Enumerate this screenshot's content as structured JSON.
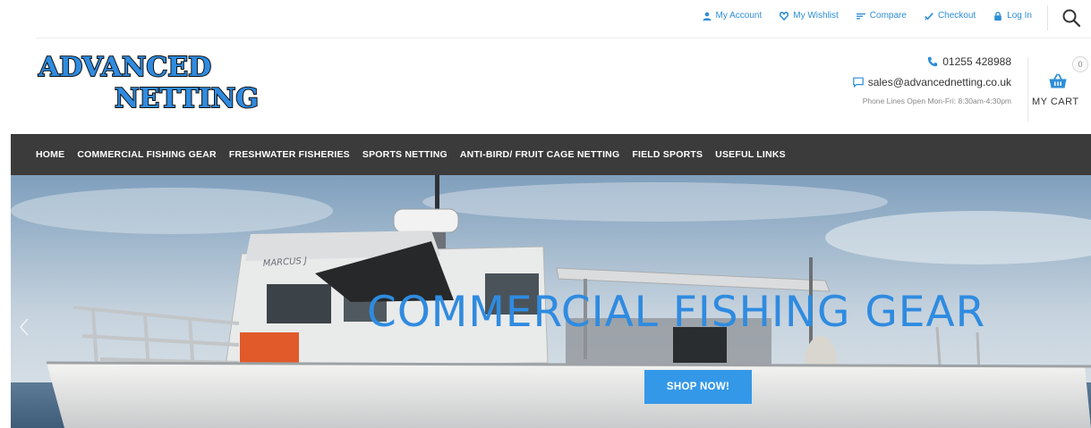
{
  "topbar": {
    "links": [
      {
        "label": "My Account",
        "icon": "user-icon"
      },
      {
        "label": "My Wishlist",
        "icon": "heart-icon"
      },
      {
        "label": "Compare",
        "icon": "compare-icon"
      },
      {
        "label": "Checkout",
        "icon": "check-icon"
      },
      {
        "label": "Log In",
        "icon": "lock-icon"
      }
    ],
    "search_icon": "search-icon"
  },
  "header": {
    "logo_line1": "ADVANCED",
    "logo_line2": "NETTING",
    "phone": "01255 428988",
    "email": "sales@advancednetting.co.uk",
    "hours": "Phone Lines Open Mon-Fri: 8:30am-4:30pm",
    "cart_count": "0",
    "cart_label": "MY CART"
  },
  "nav": {
    "items": [
      "HOME",
      "COMMERCIAL FISHING GEAR",
      "FRESHWATER FISHERIES",
      "SPORTS NETTING",
      "ANTI-BIRD/ FRUIT CAGE NETTING",
      "FIELD SPORTS",
      "USEFUL LINKS"
    ]
  },
  "hero": {
    "title": "COMMERCIAL FISHING GEAR",
    "button": "SHOP NOW!",
    "boat_name": "MARCUS J"
  },
  "colors": {
    "accent": "#2d8ed8",
    "nav_bg": "#3b3b3b",
    "button_bg": "#3498e8",
    "hero_title": "#2f8be0"
  }
}
